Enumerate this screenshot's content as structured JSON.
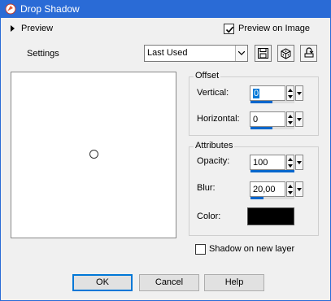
{
  "window": {
    "title": "Drop Shadow"
  },
  "header": {
    "preview_label": "Preview",
    "preview_on_image_label": "Preview on Image",
    "preview_on_image_checked": true
  },
  "settings": {
    "label": "Settings",
    "preset_value": "Last Used",
    "toolbar_icons": [
      "save-preset-icon",
      "randomize-icon",
      "reset-icon"
    ]
  },
  "offset": {
    "title": "Offset",
    "vertical_label": "Vertical:",
    "vertical_value": "0",
    "horizontal_label": "Horizontal:",
    "horizontal_value": "0"
  },
  "attributes": {
    "title": "Attributes",
    "opacity_label": "Opacity:",
    "opacity_value": "100",
    "blur_label": "Blur:",
    "blur_value": "20,00",
    "color_label": "Color:",
    "color_value": "#000000"
  },
  "shadow_on_new_layer": {
    "label": "Shadow on new layer",
    "checked": false
  },
  "buttons": {
    "ok": "OK",
    "cancel": "Cancel",
    "help": "Help"
  },
  "colors": {
    "titlebar": "#2a6bd6",
    "accent": "#0078d7"
  }
}
